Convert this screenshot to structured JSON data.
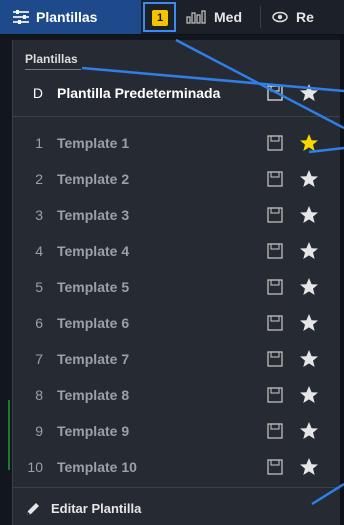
{
  "toolbar": {
    "active_tab_label": "Plantillas",
    "badge": "1",
    "med_label": "Med",
    "re_label": "Re"
  },
  "panel": {
    "title": "Plantillas",
    "default_row": {
      "index": "D",
      "name": "Plantilla Predeterminada"
    },
    "templates": [
      {
        "index": "1",
        "name": "Template 1",
        "favorite": true
      },
      {
        "index": "2",
        "name": "Template 2",
        "favorite": false
      },
      {
        "index": "3",
        "name": "Template 3",
        "favorite": false
      },
      {
        "index": "4",
        "name": "Template 4",
        "favorite": false
      },
      {
        "index": "5",
        "name": "Template 5",
        "favorite": false
      },
      {
        "index": "6",
        "name": "Template 6",
        "favorite": false
      },
      {
        "index": "7",
        "name": "Template 7",
        "favorite": false
      },
      {
        "index": "8",
        "name": "Template 8",
        "favorite": false
      },
      {
        "index": "9",
        "name": "Template 9",
        "favorite": false
      },
      {
        "index": "10",
        "name": "Template 10",
        "favorite": false
      }
    ],
    "edit_label": "Editar Plantilla"
  },
  "colors": {
    "active_tab": "#1e4a8c",
    "badge": "#f5c400",
    "star_favorite": "#f5d800",
    "star_default": "#e6e6e6",
    "annotation": "#2f7fe6"
  },
  "icons": {
    "toolbar_templates": "sliders-icon",
    "toolbar_med": "bar-chart-icon",
    "toolbar_re": "eye-icon",
    "save": "save-icon",
    "star": "star-icon",
    "edit": "pencil-icon"
  }
}
